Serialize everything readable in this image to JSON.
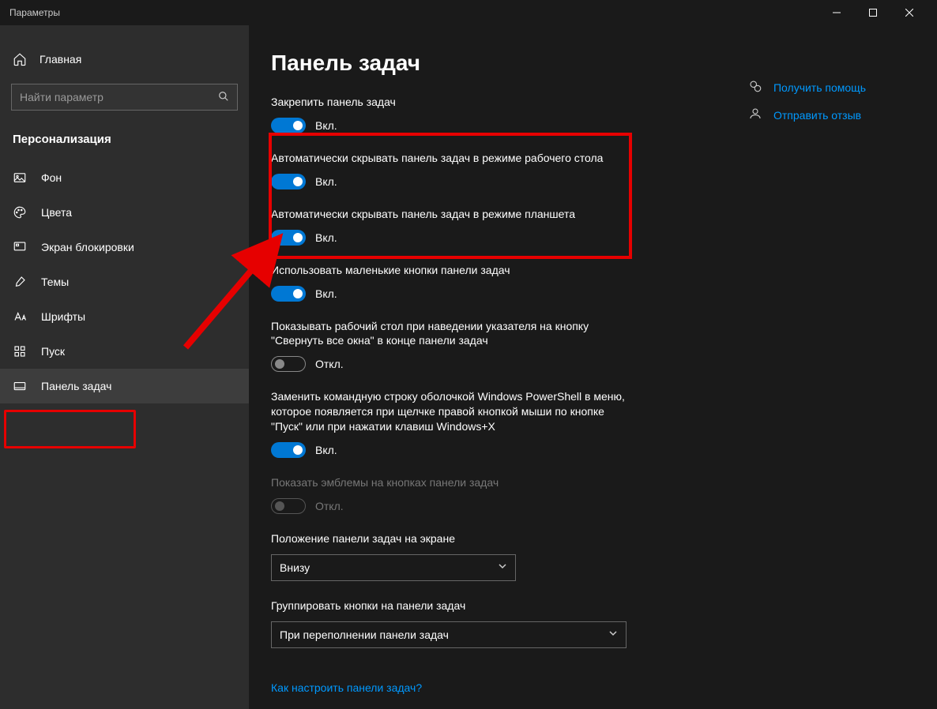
{
  "window": {
    "title": "Параметры"
  },
  "sidebar": {
    "home": "Главная",
    "search_placeholder": "Найти параметр",
    "section": "Персонализация",
    "items": [
      {
        "label": "Фон"
      },
      {
        "label": "Цвета"
      },
      {
        "label": "Экран блокировки"
      },
      {
        "label": "Темы"
      },
      {
        "label": "Шрифты"
      },
      {
        "label": "Пуск"
      },
      {
        "label": "Панель задач"
      }
    ]
  },
  "page": {
    "title": "Панель задач",
    "settings": [
      {
        "label": "Закрепить панель задач",
        "on": true,
        "state": "Вкл."
      },
      {
        "label": "Автоматически скрывать панель задач в режиме рабочего стола",
        "on": true,
        "state": "Вкл."
      },
      {
        "label": "Автоматически скрывать панель задач в режиме планшета",
        "on": true,
        "state": "Вкл."
      },
      {
        "label": "Использовать маленькие кнопки панели задач",
        "on": true,
        "state": "Вкл."
      },
      {
        "label": "Показывать рабочий стол при наведении указателя на кнопку \"Свернуть все окна\" в конце панели задач",
        "on": false,
        "state": "Откл."
      },
      {
        "label": "Заменить командную строку оболочкой Windows PowerShell в меню, которое появляется при щелчке правой кнопкой мыши по кнопке \"Пуск\" или при нажатии клавиш Windows+X",
        "on": true,
        "state": "Вкл."
      },
      {
        "label": "Показать эмблемы на кнопках панели задач",
        "on": false,
        "state": "Откл.",
        "disabled": true
      }
    ],
    "position_label": "Положение панели задач на экране",
    "position_value": "Внизу",
    "group_label": "Группировать кнопки на панели задач",
    "group_value": "При переполнении панели задач",
    "help_link": "Как настроить панели задач?"
  },
  "right": {
    "help": "Получить помощь",
    "feedback": "Отправить отзыв"
  }
}
